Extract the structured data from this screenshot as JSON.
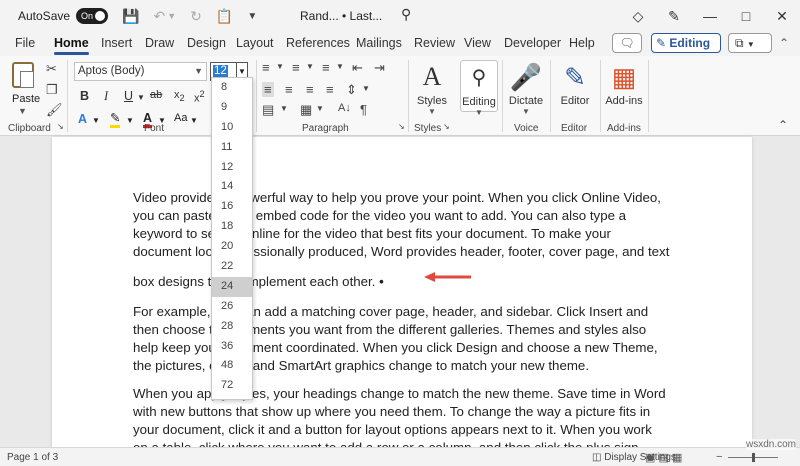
{
  "titlebar": {
    "autosave_label": "AutoSave",
    "autosave_state": "On",
    "doc_title": "Rand... • Last..."
  },
  "menu": {
    "tabs": [
      "File",
      "Home",
      "Insert",
      "Draw",
      "Design",
      "Layout",
      "References",
      "Mailings",
      "Review",
      "View",
      "Developer",
      "Help"
    ],
    "active_tab": "Home",
    "editing_label": "Editing"
  },
  "ribbon": {
    "paste_label": "Paste",
    "font_name": "Aptos (Body)",
    "font_size": "12",
    "groups": {
      "clipboard": "Clipboard",
      "font": "Font",
      "paragraph": "Paragraph",
      "styles": "Styles",
      "voice": "Voice",
      "editor": "Editor",
      "addins": "Add-ins"
    },
    "buttons": {
      "styles": "Styles",
      "editing": "Editing",
      "dictate": "Dictate",
      "editor": "Editor",
      "addins": "Add-ins"
    }
  },
  "font_size_dropdown": {
    "options": [
      "8",
      "9",
      "10",
      "11",
      "12",
      "14",
      "16",
      "18",
      "20",
      "22",
      "24",
      "26",
      "28",
      "36",
      "48",
      "72"
    ],
    "highlighted": "24"
  },
  "document": {
    "paragraph1_lines": [
      "Video provides a powerful way to help you prove your point. When you click Online Video,",
      "you can paste in the embed code for the video you want to add. You can also type a",
      "keyword to search online for the video that best fits your document. To make your",
      "document look professionally produced, Word provides header, footer, cover page, and text",
      "box designs that complement each other."
    ],
    "paragraph2_lines": [
      "For example, you can add a matching cover page, header, and sidebar. Click Insert and",
      "then choose the elements you want from the different galleries. Themes and styles also",
      "help keep your document coordinated. When you click Design and choose a new Theme,",
      "the pictures, charts, and SmartArt graphics change to match your new theme."
    ],
    "paragraph3_lines": [
      "When you apply styles, your headings change to match the new theme. Save time in Word",
      "with new buttons that show up where you need them. To change the way a picture fits in",
      "your document, click it and a button for layout options appears next to it. When you work",
      "on a table, click where you want to add a row or a column, and then click the plus sign."
    ],
    "arrow_color": "#e04a3c"
  },
  "statusbar": {
    "pages": "Page 1 of 3",
    "display_settings": "Display Settings"
  },
  "watermark": "wsxdn.com",
  "colors": {
    "accent": "#2b579a",
    "highlight_yellow": "#ffd800",
    "font_red": "#d11b1b"
  }
}
